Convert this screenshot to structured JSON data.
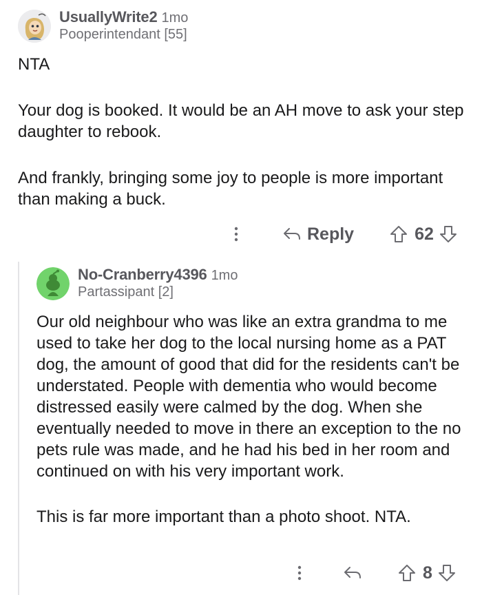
{
  "comment1": {
    "username": "UsuallyWrite2",
    "age": "1mo",
    "flair": "Pooperintendant [55]",
    "paragraphs": [
      "NTA",
      "Your dog is booked. It would be an AH move to ask your step daughter to rebook.",
      "And frankly, bringing some joy to people is more important than making a buck."
    ],
    "reply_label": "Reply",
    "score": "62"
  },
  "comment2": {
    "username": "No-Cranberry4396",
    "age": "1mo",
    "flair": "Partassipant [2]",
    "paragraphs": [
      "Our old neighbour who was like an extra grandma to me used to take her dog to the local nursing home as a PAT dog, the amount of good that did for the residents can't be understated. People with dementia who would become distressed easily were calmed by the dog. When she eventually needed to move in there an exception to the no pets rule was made, and he had his bed in her room and continued on with his very important work.",
      "This is far more important than a photo shoot. NTA."
    ],
    "score": "8"
  },
  "colors": {
    "avatar2_bg": "#71d36b",
    "avatar2_fg": "#3f8a36",
    "action_gray": "#6b6b70",
    "thread_line": "#e3e3e6"
  },
  "icons": [
    "more-vertical-icon",
    "reply-arrow-icon",
    "upvote-icon",
    "downvote-icon",
    "snoo-avatar-icon"
  ]
}
